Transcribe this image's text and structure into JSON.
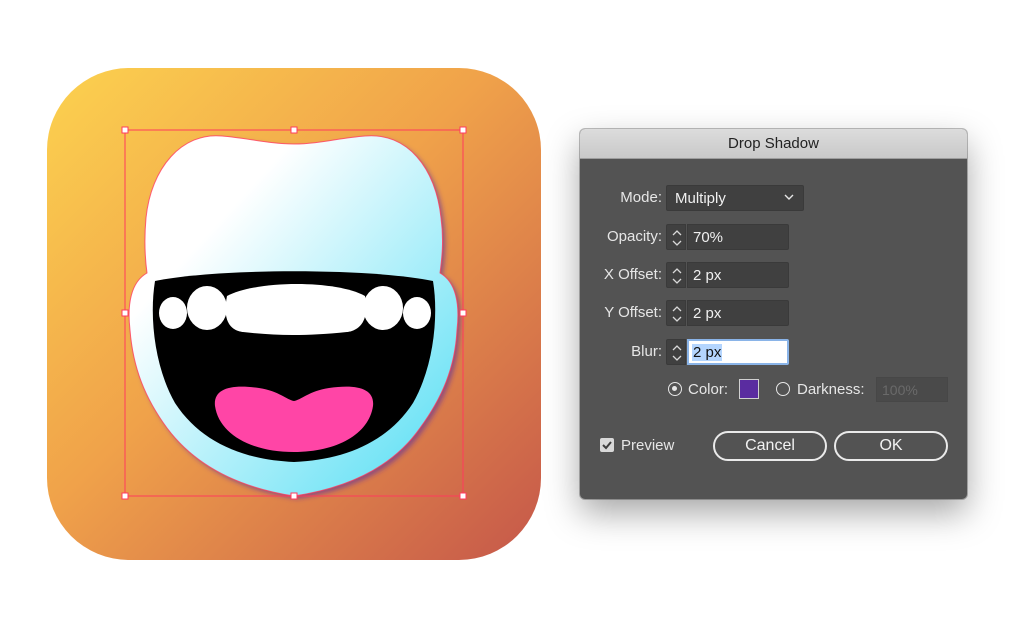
{
  "artwork": {
    "background_gradient": [
      "#fcd24f",
      "#f2a24a",
      "#c5574a"
    ],
    "face_gradient": [
      "#ffffff",
      "#7ee6f6"
    ],
    "mouth_color": "#000000",
    "tongue_color": "#ff45a6",
    "selection_color": "#ff3b5c"
  },
  "dialog": {
    "title": "Drop Shadow",
    "mode": {
      "label": "Mode:",
      "value": "Multiply"
    },
    "opacity": {
      "label": "Opacity:",
      "value": "70%"
    },
    "x_offset": {
      "label": "X Offset:",
      "value": "2 px"
    },
    "y_offset": {
      "label": "Y Offset:",
      "value": "2 px"
    },
    "blur": {
      "label": "Blur:",
      "value": "2 px"
    },
    "color": {
      "label": "Color:",
      "swatch": "#5a2ca0",
      "selected": true
    },
    "darkness": {
      "label": "Darkness:",
      "value": "100%",
      "selected": false
    },
    "preview": {
      "label": "Preview",
      "checked": true
    },
    "cancel_label": "Cancel",
    "ok_label": "OK"
  }
}
